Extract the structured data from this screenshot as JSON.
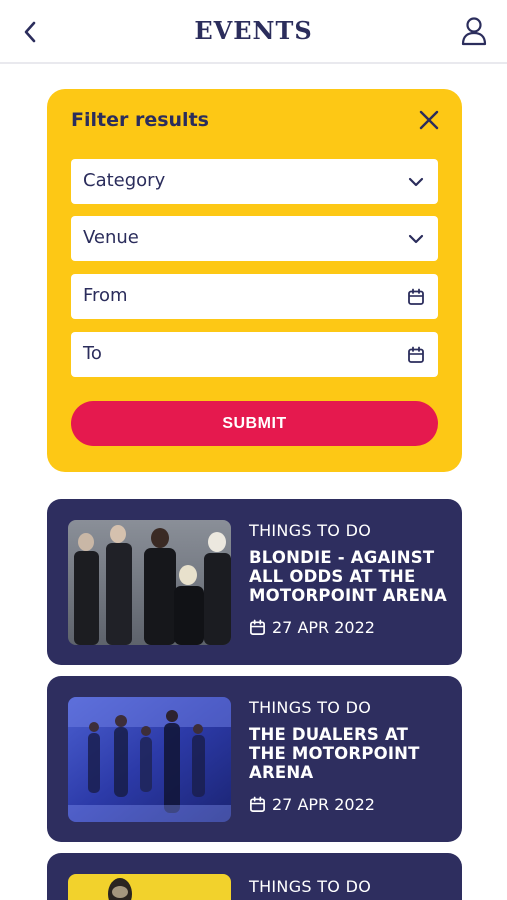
{
  "header": {
    "title": "EVENTS"
  },
  "filter": {
    "title": "Filter results",
    "fields": [
      {
        "label": "Category"
      },
      {
        "label": "Venue"
      },
      {
        "label": "From"
      },
      {
        "label": "To"
      }
    ],
    "submit_label": "SUBMIT"
  },
  "events": [
    {
      "category": "THINGS TO DO",
      "title": "BLONDIE - AGAINST ALL ODDS AT THE MOTORPOINT ARENA",
      "date": "27 APR 2022"
    },
    {
      "category": "THINGS TO DO",
      "title": "THE DUALERS AT THE MOTORPOINT ARENA",
      "date": "27 APR 2022"
    },
    {
      "category": "THINGS TO DO"
    }
  ],
  "colors": {
    "navy": "#2b2d5c",
    "panel_yellow": "#fdc815",
    "submit_red": "#e5194e",
    "card_navy": "#2e2e5f"
  }
}
